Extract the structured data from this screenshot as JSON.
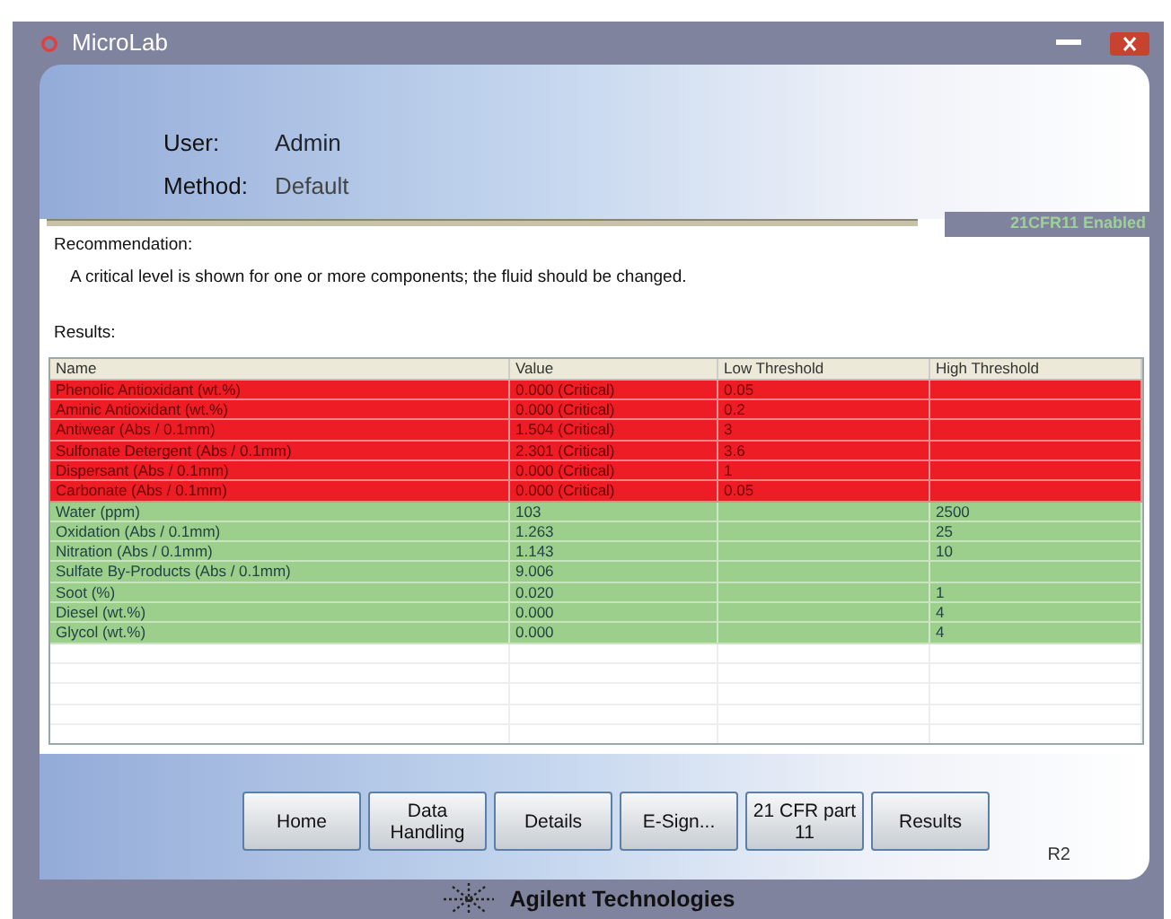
{
  "window": {
    "title": "MicroLab"
  },
  "header": {
    "fields": [
      {
        "label": "User:",
        "value": "Admin"
      },
      {
        "label": "Method:",
        "value": "Default"
      }
    ],
    "badge": "21CFR11 Enabled"
  },
  "recommendation": {
    "label": "Recommendation:",
    "text": "A critical level is shown for one or more components; the fluid should be changed."
  },
  "results": {
    "label": "Results:",
    "columns": [
      "Name",
      "Value",
      "Low Threshold",
      "High Threshold"
    ],
    "rows": [
      {
        "critical": true,
        "cells": [
          "Phenolic Antioxidant (wt.%)",
          "0.000 (Critical)",
          "0.05",
          ""
        ]
      },
      {
        "critical": true,
        "cells": [
          "Aminic Antioxidant (wt.%)",
          "0.000 (Critical)",
          "0.2",
          ""
        ]
      },
      {
        "critical": true,
        "cells": [
          "Antiwear (Abs / 0.1mm)",
          "1.504 (Critical)",
          "3",
          ""
        ]
      },
      {
        "critical": true,
        "cells": [
          "Sulfonate Detergent (Abs / 0.1mm)",
          "2.301 (Critical)",
          "3.6",
          ""
        ]
      },
      {
        "critical": true,
        "cells": [
          "Dispersant (Abs / 0.1mm)",
          "0.000 (Critical)",
          "1",
          ""
        ]
      },
      {
        "critical": true,
        "cells": [
          "Carbonate (Abs / 0.1mm)",
          "0.000 (Critical)",
          "0.05",
          ""
        ]
      },
      {
        "critical": false,
        "cells": [
          "Water (ppm)",
          "103",
          "",
          "2500"
        ]
      },
      {
        "critical": false,
        "cells": [
          "Oxidation (Abs / 0.1mm)",
          "1.263",
          "",
          "25"
        ]
      },
      {
        "critical": false,
        "cells": [
          "Nitration (Abs / 0.1mm)",
          "1.143",
          "",
          "10"
        ]
      },
      {
        "critical": false,
        "cells": [
          "Sulfate By-Products (Abs / 0.1mm)",
          "9.006",
          "",
          ""
        ]
      },
      {
        "critical": false,
        "cells": [
          "Soot (%)",
          "0.020",
          "",
          "1"
        ]
      },
      {
        "critical": false,
        "cells": [
          "Diesel (wt.%)",
          "0.000",
          "",
          "4"
        ]
      },
      {
        "critical": false,
        "cells": [
          "Glycol (wt.%)",
          "0.000",
          "",
          "4"
        ]
      }
    ]
  },
  "buttons": [
    "Home",
    "Data Handling",
    "Details",
    "E-Sign...",
    "21 CFR part 11",
    "Results"
  ],
  "revision": "R2",
  "footer": {
    "company": "Agilent Technologies"
  }
}
